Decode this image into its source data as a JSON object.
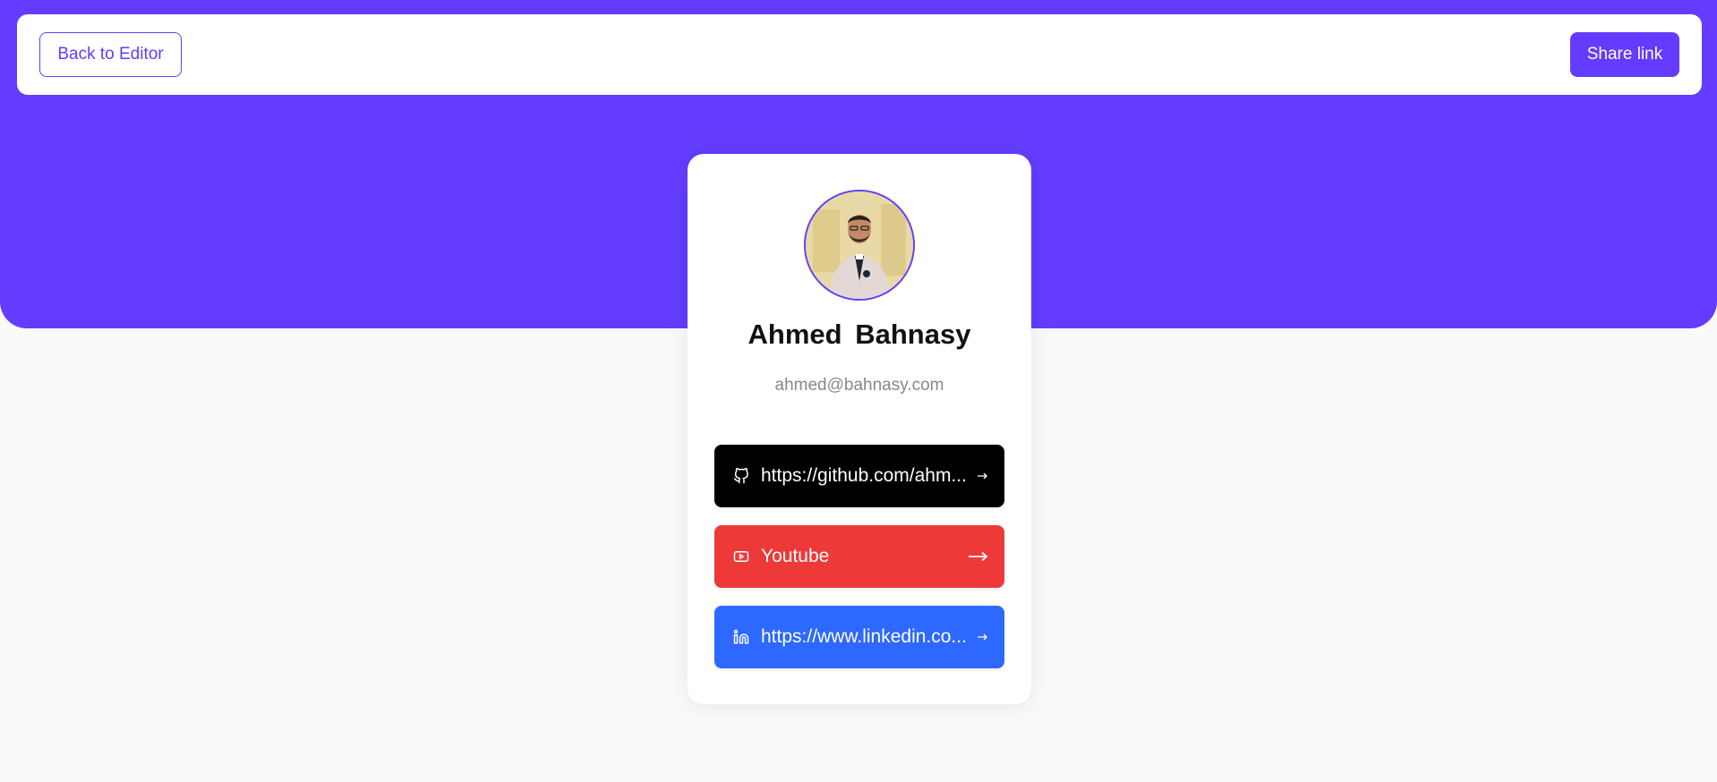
{
  "colors": {
    "accent": "#633cff",
    "github": "#000000",
    "youtube": "#ee3939",
    "linkedin": "#2d68ff"
  },
  "header": {
    "back_label": "Back to Editor",
    "share_label": "Share link"
  },
  "profile": {
    "name": "Ahmed  Bahnasy",
    "email": "ahmed@bahnasy.com",
    "avatar_icon": "profile-photo"
  },
  "links": [
    {
      "platform": "GitHub",
      "icon": "github-icon",
      "label": "https://github.com/ahm..."
    },
    {
      "platform": "YouTube",
      "icon": "youtube-icon",
      "label": "Youtube"
    },
    {
      "platform": "LinkedIn",
      "icon": "linkedin-icon",
      "label": "https://www.linkedin.co..."
    }
  ]
}
